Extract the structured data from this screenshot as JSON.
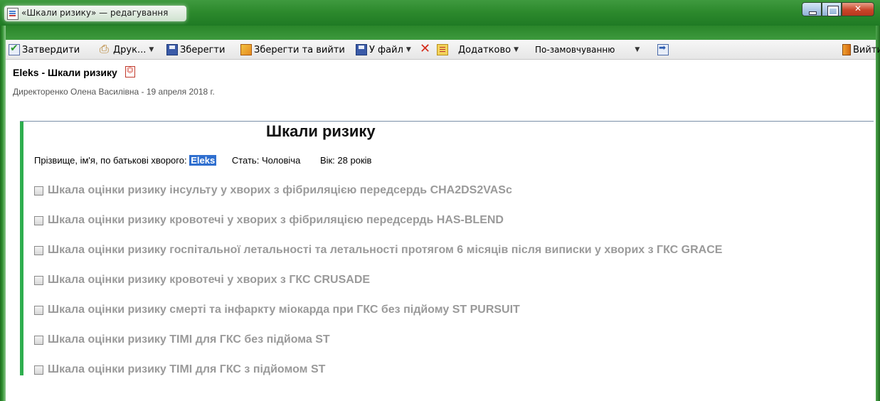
{
  "window": {
    "title": "«Шкали ризику» — редагування",
    "buttons": [
      "minimize",
      "maximize",
      "close"
    ]
  },
  "toolbar": {
    "approve": "Затвердити",
    "print": "Друк...",
    "save": "Зберегти",
    "save_exit": "Зберегти та вийти",
    "to_file": "У файл",
    "additional": "Додатково",
    "template_value": "По-замовчуванню",
    "exit": "Вийти"
  },
  "document": {
    "title": "Eleks - Шкали ризику",
    "author_line": "Директоренко Олена Василівна - 19 апреля 2018 г."
  },
  "form": {
    "title": "Шкали ризику",
    "patient_label": "Прізвище, ім'я, по батькові хворого:",
    "patient_name": "Eleks",
    "sex_label": "Стать:",
    "sex_value": "Чоловіча",
    "age_label": "Вік:",
    "age_value": "28 років"
  },
  "scales": [
    {
      "label": "Шкала оцінки ризику інсульту у хворих з фібриляцією передсердь CHA2DS2VASc",
      "checked": false
    },
    {
      "label": "Шкала оцінки ризику кровотечі у хворих з фібриляцією передсердь HAS-BLEND",
      "checked": false
    },
    {
      "label": "Шкала оцінки ризику госпітальної летальності та летальності протягом 6 місяців після виписки у хворих з ГКС GRACE",
      "checked": false
    },
    {
      "label": "Шкала оцінки ризику кровотечі у хворих з ГКС CRUSADE",
      "checked": false
    },
    {
      "label": "Шкала оцінки ризику смерті та інфаркту міокарда при ГКС без підйому ST PURSUIT",
      "checked": false
    },
    {
      "label": "Шкала оцінки ризику TIMI  для ГКС без підйома ST",
      "checked": false
    },
    {
      "label": "Шкала оцінки ризику TIMI  для ГКС з підйомом ST",
      "checked": false
    }
  ],
  "colors": {
    "accent": "#2eae4e",
    "titlebar": "#2d8a2d",
    "highlight": "#2f6fcf",
    "disabled_text": "#9a9a9a"
  }
}
